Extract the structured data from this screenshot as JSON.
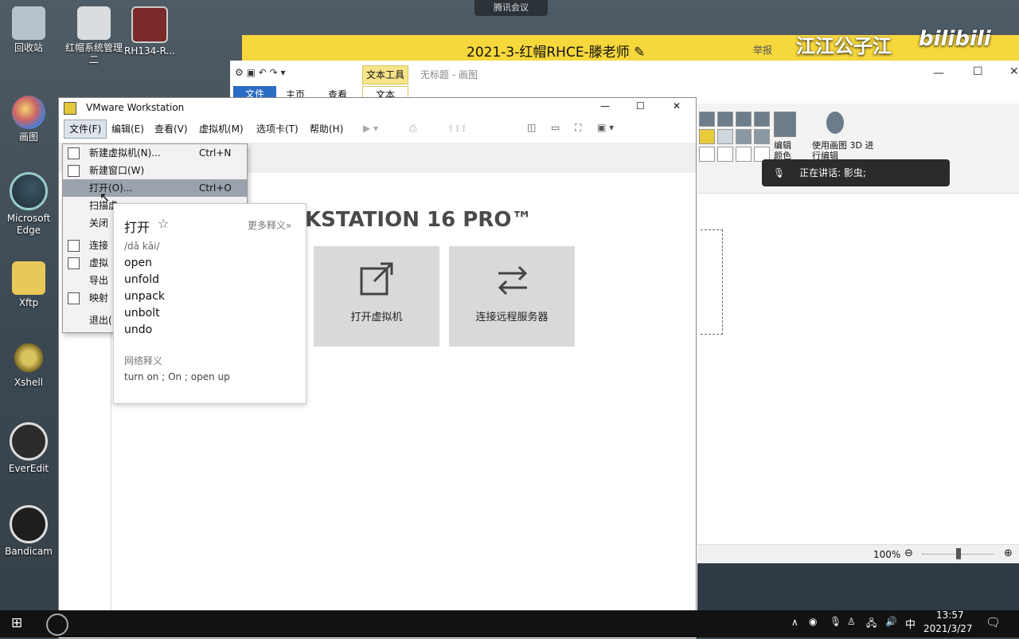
{
  "meeting": {
    "top_label": "腾讯会议",
    "banner_title": "2021-3-红帽RHCE-滕老师",
    "banner_right": "举报",
    "watermark": "江江公子江",
    "speaking": "正在讲话: 影虫;"
  },
  "desktop_icons": [
    {
      "label": "回收站",
      "icon": "recycle-bin-icon"
    },
    {
      "label": "红帽系统管理二",
      "icon": "document-icon"
    },
    {
      "label": "RH134-R...",
      "icon": "book-icon"
    },
    {
      "label": "画图",
      "icon": "paint-icon"
    },
    {
      "label": "Microsoft Edge",
      "icon": "edge-icon"
    },
    {
      "label": "Xftp",
      "icon": "xftp-icon"
    },
    {
      "label": "Xshell",
      "icon": "xshell-icon"
    },
    {
      "label": "EverEdit",
      "icon": "everedit-icon"
    },
    {
      "label": "Bandicam",
      "icon": "bandicam-icon"
    }
  ],
  "paint": {
    "title": "无标题 - 画图",
    "context_tab": "文本工具",
    "tabs": [
      "文件",
      "主页",
      "查看",
      "文本"
    ],
    "edit_colors": "编辑颜色",
    "paint3d": "使用画图 3D 进行编辑",
    "zoom": "100%"
  },
  "vmware": {
    "title": "VMware Workstation",
    "menu": [
      "文件(F)",
      "编辑(E)",
      "查看(V)",
      "虚拟机(M)",
      "选项卡(T)",
      "帮助(H)"
    ],
    "heading": "KSTATION 16 PRO™",
    "tiles": [
      {
        "label": "打开虚拟机"
      },
      {
        "label": "连接远程服务器"
      }
    ],
    "logo": "vmware"
  },
  "file_menu": [
    {
      "label": "新建虚拟机(N)...",
      "shortcut": "Ctrl+N"
    },
    {
      "label": "新建窗口(W)",
      "shortcut": ""
    },
    {
      "label": "打开(O)...",
      "shortcut": "Ctrl+O"
    },
    {
      "label": "扫描虚",
      "shortcut": ""
    },
    {
      "label": "关闭",
      "shortcut": ""
    },
    {
      "label": "连接",
      "shortcut": ""
    },
    {
      "label": "虚拟",
      "shortcut": ""
    },
    {
      "label": "导出",
      "shortcut": ""
    },
    {
      "label": "映射",
      "shortcut": ""
    },
    {
      "label": "退出(",
      "shortcut": ""
    }
  ],
  "dictionary": {
    "word": "打开",
    "more": "更多释义»",
    "pinyin": "/dǎ kāi/",
    "meanings": [
      "open",
      "unfold",
      "unpack",
      "unbolt",
      "undo"
    ],
    "web_heading": "网络释义",
    "web_meanings": "turn on ; On ; open up"
  },
  "taskbar": {
    "ime": "中",
    "time": "13:57",
    "date": "2021/3/27"
  }
}
